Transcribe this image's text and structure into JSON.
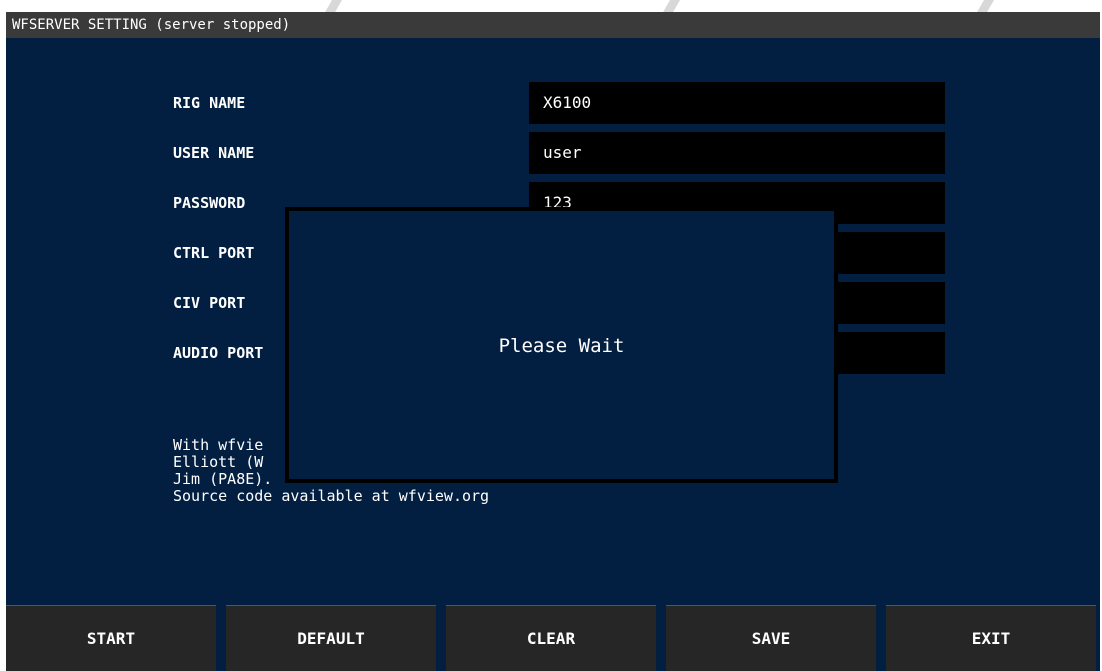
{
  "window": {
    "title": "WFSERVER SETTING (server stopped)"
  },
  "fields": [
    {
      "label": "RIG NAME",
      "value": "X6100"
    },
    {
      "label": "USER NAME",
      "value": "user"
    },
    {
      "label": "PASSWORD",
      "value": "123"
    },
    {
      "label": "CTRL PORT",
      "value": ""
    },
    {
      "label": "CIV PORT",
      "value": ""
    },
    {
      "label": "AUDIO PORT",
      "value": ""
    }
  ],
  "about": {
    "line1": "With wfvie",
    "line2": "Elliott (W",
    "line3": "Jim (PA8E).",
    "line4": "Source code available at wfview.org"
  },
  "dialog": {
    "message": "Please Wait"
  },
  "buttons": {
    "start": "START",
    "default": "DEFAULT",
    "clear": "CLEAR",
    "save": "SAVE",
    "exit": "EXIT"
  }
}
